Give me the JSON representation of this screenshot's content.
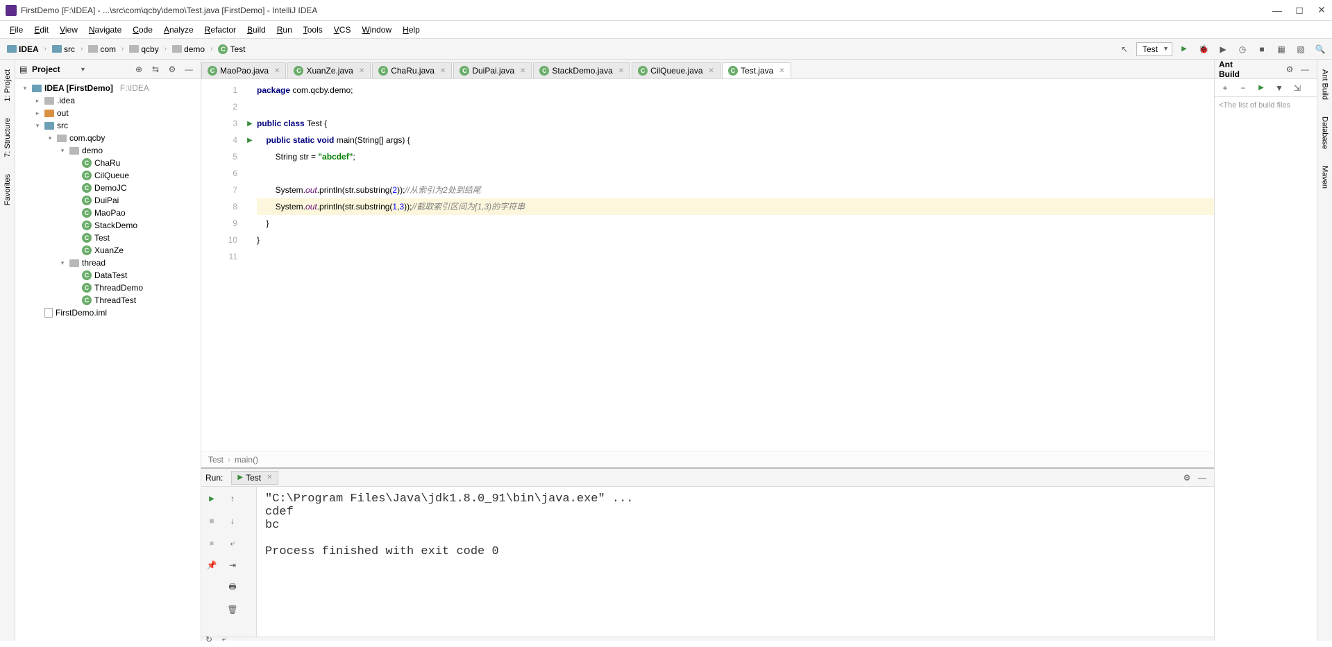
{
  "title": "FirstDemo [F:\\IDEA] - ...\\src\\com\\qcby\\demo\\Test.java [FirstDemo] - IntelliJ IDEA",
  "menu": [
    "File",
    "Edit",
    "View",
    "Navigate",
    "Code",
    "Analyze",
    "Refactor",
    "Build",
    "Run",
    "Tools",
    "VCS",
    "Window",
    "Help"
  ],
  "breadcrumbs": [
    {
      "icon": "folder-blue",
      "label": "IDEA",
      "bold": true
    },
    {
      "icon": "folder-blue",
      "label": "src"
    },
    {
      "icon": "folder-gray",
      "label": "com"
    },
    {
      "icon": "folder-gray",
      "label": "qcby"
    },
    {
      "icon": "folder-gray",
      "label": "demo"
    },
    {
      "icon": "class",
      "label": "Test"
    }
  ],
  "run_config": "Test",
  "project_panel": {
    "title": "Project"
  },
  "tree": [
    {
      "depth": 0,
      "toggle": "▾",
      "icon": "folder-blue",
      "label": "IDEA [FirstDemo]",
      "detail": "F:\\IDEA",
      "bold": true
    },
    {
      "depth": 1,
      "toggle": "▸",
      "icon": "folder-gray",
      "label": ".idea"
    },
    {
      "depth": 1,
      "toggle": "▸",
      "icon": "folder-orange",
      "label": "out"
    },
    {
      "depth": 1,
      "toggle": "▾",
      "icon": "folder-blue",
      "label": "src"
    },
    {
      "depth": 2,
      "toggle": "▾",
      "icon": "folder-gray",
      "label": "com.qcby"
    },
    {
      "depth": 3,
      "toggle": "▾",
      "icon": "folder-gray",
      "label": "demo"
    },
    {
      "depth": 4,
      "toggle": "",
      "icon": "class",
      "label": "ChaRu"
    },
    {
      "depth": 4,
      "toggle": "",
      "icon": "class",
      "label": "CilQueue"
    },
    {
      "depth": 4,
      "toggle": "",
      "icon": "class",
      "label": "DemoJC"
    },
    {
      "depth": 4,
      "toggle": "",
      "icon": "class",
      "label": "DuiPai"
    },
    {
      "depth": 4,
      "toggle": "",
      "icon": "class",
      "label": "MaoPao"
    },
    {
      "depth": 4,
      "toggle": "",
      "icon": "class",
      "label": "StackDemo"
    },
    {
      "depth": 4,
      "toggle": "",
      "icon": "class",
      "label": "Test"
    },
    {
      "depth": 4,
      "toggle": "",
      "icon": "class",
      "label": "XuanZe"
    },
    {
      "depth": 3,
      "toggle": "▾",
      "icon": "folder-gray",
      "label": "thread"
    },
    {
      "depth": 4,
      "toggle": "",
      "icon": "class",
      "label": "DataTest"
    },
    {
      "depth": 4,
      "toggle": "",
      "icon": "class",
      "label": "ThreadDemo"
    },
    {
      "depth": 4,
      "toggle": "",
      "icon": "class",
      "label": "ThreadTest"
    },
    {
      "depth": 1,
      "toggle": "",
      "icon": "file",
      "label": "FirstDemo.iml"
    }
  ],
  "tabs": [
    {
      "label": "MaoPao.java"
    },
    {
      "label": "XuanZe.java"
    },
    {
      "label": "ChaRu.java"
    },
    {
      "label": "DuiPai.java"
    },
    {
      "label": "StackDemo.java"
    },
    {
      "label": "CilQueue.java"
    },
    {
      "label": "Test.java",
      "active": true
    }
  ],
  "code": {
    "lines": [
      1,
      2,
      3,
      4,
      5,
      6,
      7,
      8,
      9,
      10,
      11
    ],
    "markers": {
      "3": "▶",
      "4": "▶"
    },
    "l1": {
      "a": "package",
      "b": " com.qcby.demo;"
    },
    "l3": {
      "a": "public class",
      "b": " Test {"
    },
    "l4": {
      "a": "public static void",
      "b": " main(String[] args) {"
    },
    "l5": {
      "a": "String str = ",
      "s": "\"abcdef\"",
      "b": ";"
    },
    "l7": {
      "a": "System.",
      "f": "out",
      "b": ".println(str.substring(",
      "n": "2",
      "c": "));",
      "cm": "//从索引为2处到结尾"
    },
    "l8": {
      "a": "System.",
      "f": "out",
      "b": ".println(str.substring(",
      "n1": "1",
      "m": ",",
      "n2": "3",
      "c": "));",
      "cm": "//截取索引区间为[1,3)的字符串"
    },
    "l9": "    }",
    "l10": "}"
  },
  "code_breadcrumb": {
    "a": "Test",
    "b": "main()"
  },
  "run_panel": {
    "label": "Run:",
    "tab": "Test",
    "output": "\"C:\\Program Files\\Java\\jdk1.8.0_91\\bin\\java.exe\" ...\ncdef\nbc\n\nProcess finished with exit code 0"
  },
  "ant": {
    "title": "Ant Build",
    "msg": "<The list of build files"
  },
  "left_tabs": [
    "1: Project",
    "7: Structure",
    "Favorites"
  ],
  "right_tabs": [
    "Ant Build",
    "Database",
    "Maven"
  ]
}
